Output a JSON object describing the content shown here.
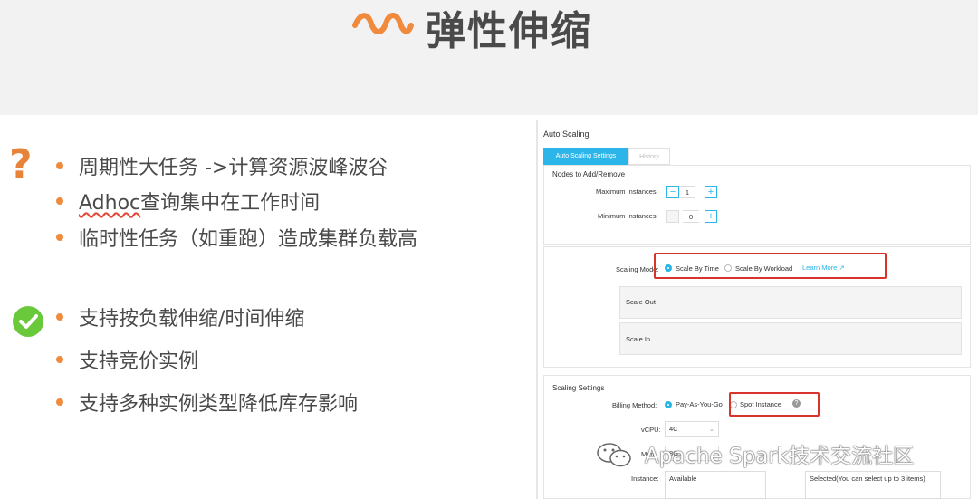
{
  "slide": {
    "title": "弹性伸缩",
    "problems": [
      "周期性大任务 ->计算资源波峰波谷",
      "Adhoc查询集中在工作时间",
      "临时性任务（如重跑）造成集群负载高"
    ],
    "solutions": [
      "支持按负载伸缩/时间伸缩",
      "支持竞价实例",
      "支持多种实例类型降低库存影响"
    ],
    "problem_icon": "question-mark-icon",
    "solution_icon": "checkmark-icon",
    "accent_orange": "#f08a3c",
    "accent_green": "#6ac93b"
  },
  "panel": {
    "title": "Auto Scaling",
    "tabs": [
      "Auto Scaling Settings",
      "History"
    ],
    "nodes_section": {
      "heading": "Nodes to Add/Remove",
      "max_label": "Maximum Instances:",
      "max_value": "1",
      "min_label": "Minimum Instances:",
      "min_value": "0"
    },
    "mode_section": {
      "label": "Scaling Mode:",
      "option_time": "Scale By Time",
      "option_workload": "Scale By Workload",
      "learn_more": "Learn More",
      "scale_out": "Scale Out",
      "scale_in": "Scale In"
    },
    "settings_section": {
      "heading": "Scaling Settings",
      "billing_label": "Billing Method:",
      "billing_payg": "Pay-As-You-Go",
      "billing_spot": "Spot Instance",
      "vcpu_label": "vCPU:",
      "vcpu_value": "4C",
      "mem_label": "Mem",
      "mem_value": "8G",
      "instance_label": "Instance:",
      "available_label": "Available",
      "selected_label": "Selected(You can select up to 3 items)"
    },
    "accent_blue": "#2bb5e8",
    "highlight_red": "#d9342b"
  },
  "watermark": "Apache Spark技术交流社区"
}
